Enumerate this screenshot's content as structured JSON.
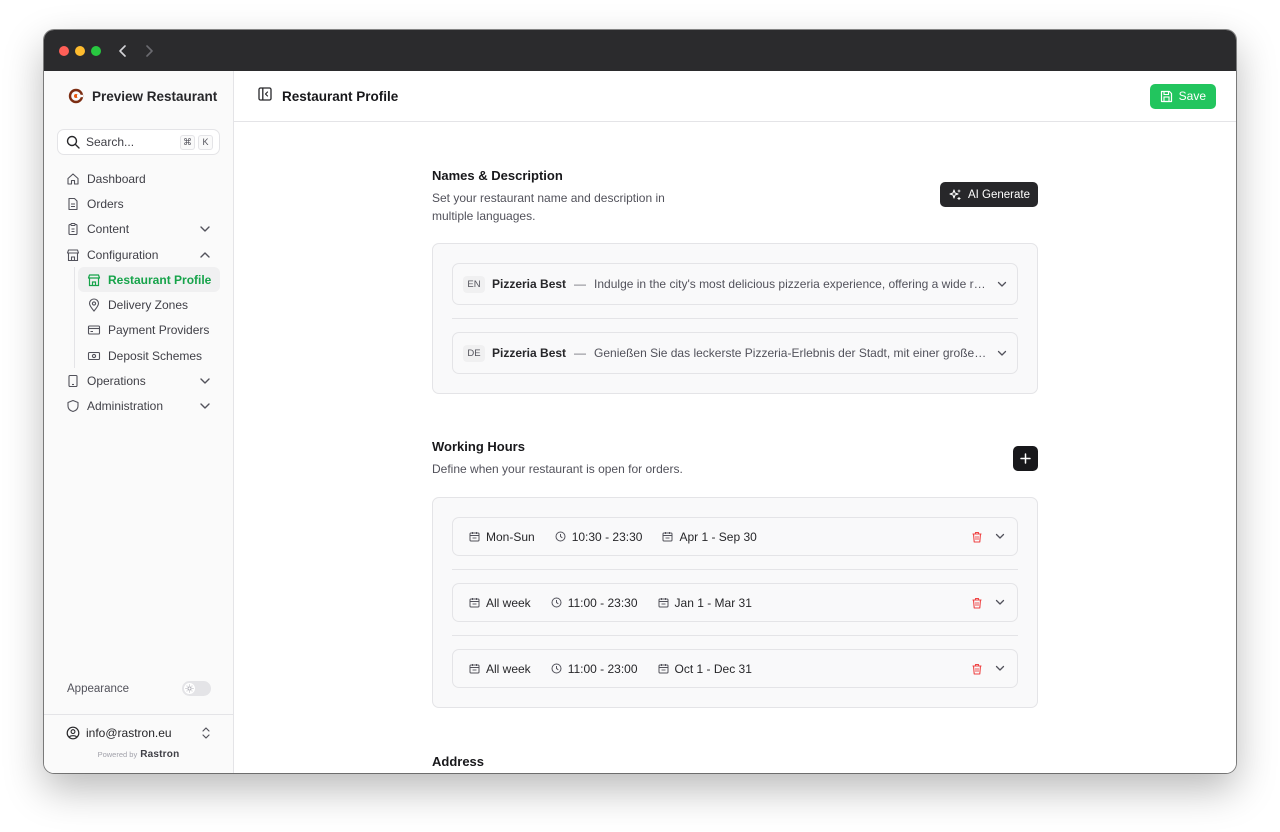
{
  "window": {
    "title": "Restaurant Profile"
  },
  "sidebar": {
    "brand": "Preview Restaurant",
    "search": {
      "placeholder": "Search...",
      "shortcut_mod": "⌘",
      "shortcut_key": "K"
    },
    "items": [
      {
        "label": "Dashboard",
        "icon": "home-icon"
      },
      {
        "label": "Orders",
        "icon": "document-icon"
      },
      {
        "label": "Content",
        "icon": "clipboard-icon",
        "expandable": true
      },
      {
        "label": "Configuration",
        "icon": "store-icon",
        "expanded": true
      },
      {
        "label": "Operations",
        "icon": "tablet-icon",
        "expandable": true
      },
      {
        "label": "Administration",
        "icon": "shield-icon",
        "expandable": true
      }
    ],
    "configuration_items": [
      {
        "label": "Restaurant Profile",
        "icon": "store-icon",
        "active": true
      },
      {
        "label": "Delivery Zones",
        "icon": "map-pin-icon"
      },
      {
        "label": "Payment Providers",
        "icon": "credit-card-icon"
      },
      {
        "label": "Deposit Schemes",
        "icon": "banknote-icon"
      }
    ],
    "appearance_label": "Appearance",
    "account_email": "info@rastron.eu",
    "powered_by": "Powered by",
    "powered_logo": "Rastron"
  },
  "header": {
    "title": "Restaurant Profile",
    "save_label": "Save"
  },
  "names": {
    "title": "Names & Description",
    "description": "Set your restaurant name and description in multiple languages.",
    "ai_label": "AI Generate",
    "languages": [
      {
        "code": "EN",
        "name": "Pizzeria Best",
        "separator": "—",
        "description": "Indulge in the city's most delicious pizzeria experience, offering a wide range of freshly baked pizzas"
      },
      {
        "code": "DE",
        "name": "Pizzeria Best",
        "separator": "—",
        "description": "Genießen Sie das leckerste Pizzeria-Erlebnis der Stadt, mit einer großen Auswahl an frisch gebackenen Pizzen"
      }
    ]
  },
  "hours": {
    "title": "Working Hours",
    "description": "Define when your restaurant is open for orders.",
    "rows": [
      {
        "days": "Mon-Sun",
        "time": "10:30 - 23:30",
        "dates": "Apr 1 - Sep 30"
      },
      {
        "days": "All week",
        "time": "11:00 - 23:30",
        "dates": "Jan 1 - Mar 31"
      },
      {
        "days": "All week",
        "time": "11:00 - 23:00",
        "dates": "Oct 1 - Dec 31"
      }
    ]
  },
  "address": {
    "title": "Address"
  },
  "colors": {
    "accent": "#22c55e",
    "active_text": "#16a34a",
    "danger": "#ef4444",
    "dark_button": "#27272a"
  }
}
